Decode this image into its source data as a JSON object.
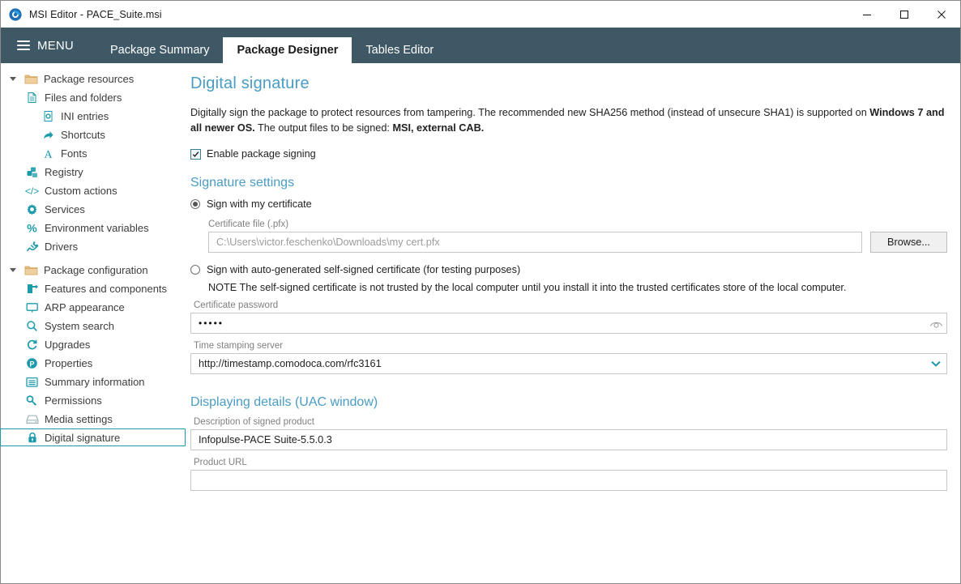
{
  "window": {
    "title": "MSI Editor - PACE_Suite.msi",
    "app_icon": "pace-logo-icon",
    "controls": {
      "minimize": "minimize-icon",
      "maximize": "maximize-icon",
      "close": "close-icon"
    }
  },
  "topbar": {
    "menu_label": "MENU",
    "tabs": [
      {
        "label": "Package Summary",
        "active": false
      },
      {
        "label": "Package Designer",
        "active": true
      },
      {
        "label": "Tables Editor",
        "active": false
      }
    ]
  },
  "sidebar": {
    "items": [
      {
        "label": "Package resources",
        "level": 0,
        "icon": "folder-icon",
        "expanded": true,
        "selected": false
      },
      {
        "label": "Files and folders",
        "level": 1,
        "icon": "document-icon",
        "selected": false
      },
      {
        "label": "INI entries",
        "level": 2,
        "icon": "ini-file-icon",
        "selected": false
      },
      {
        "label": "Shortcuts",
        "level": 2,
        "icon": "shortcut-icon",
        "selected": false
      },
      {
        "label": "Fonts",
        "level": 2,
        "icon": "font-icon",
        "selected": false
      },
      {
        "label": "Registry",
        "level": 1,
        "icon": "registry-icon",
        "selected": false
      },
      {
        "label": "Custom actions",
        "level": 1,
        "icon": "code-icon",
        "selected": false
      },
      {
        "label": "Services",
        "level": 1,
        "icon": "gear-icon",
        "selected": false
      },
      {
        "label": "Environment variables",
        "level": 1,
        "icon": "percent-icon",
        "selected": false
      },
      {
        "label": "Drivers",
        "level": 1,
        "icon": "plug-icon",
        "selected": false
      },
      {
        "label": "Package configuration",
        "level": 0,
        "icon": "folder-icon",
        "expanded": true,
        "selected": false
      },
      {
        "label": "Features and components",
        "level": 1,
        "icon": "features-icon",
        "selected": false
      },
      {
        "label": "ARP appearance",
        "level": 1,
        "icon": "monitor-icon",
        "selected": false
      },
      {
        "label": "System search",
        "level": 1,
        "icon": "search-icon",
        "selected": false
      },
      {
        "label": "Upgrades",
        "level": 1,
        "icon": "refresh-icon",
        "selected": false
      },
      {
        "label": "Properties",
        "level": 1,
        "icon": "properties-icon",
        "selected": false
      },
      {
        "label": "Summary information",
        "level": 1,
        "icon": "list-icon",
        "selected": false
      },
      {
        "label": "Permissions",
        "level": 1,
        "icon": "key-icon",
        "selected": false
      },
      {
        "label": "Media settings",
        "level": 1,
        "icon": "media-icon",
        "selected": false
      },
      {
        "label": "Digital signature",
        "level": 1,
        "icon": "lock-icon",
        "selected": true
      }
    ]
  },
  "page": {
    "title": "Digital signature",
    "description": {
      "part1": "Digitally sign the package to protect resources from tampering. The recommended new SHA256 method (instead of unsecure SHA1) is supported on ",
      "bold1": "Windows 7 and all newer OS.",
      "part2": " The output files to be signed: ",
      "bold2": "MSI, external CAB."
    },
    "enable_signing": {
      "label": "Enable package signing",
      "checked": true
    },
    "signature_settings": {
      "heading": "Signature settings",
      "option_my_cert": {
        "label": "Sign with my certificate",
        "selected": true
      },
      "cert_file": {
        "label": "Certificate file (.pfx)",
        "value": "C:\\Users\\victor.feschenko\\Downloads\\my cert.pfx",
        "is_placeholder": true,
        "browse_label": "Browse..."
      },
      "option_self_signed": {
        "label": "Sign with auto-generated self-signed certificate (for testing purposes)",
        "selected": false
      },
      "note": "NOTE The self-signed certificate is not trusted by the local computer until you install it into the trusted certificates store of the local computer.",
      "password": {
        "label": "Certificate password",
        "value": "•••••",
        "reveal_icon": "eye-icon"
      },
      "timestamp_server": {
        "label": "Time stamping server",
        "value": "http://timestamp.comodoca.com/rfc3161",
        "dropdown_icon": "chevron-down-icon"
      }
    },
    "uac": {
      "heading": "Displaying details (UAC window)",
      "description": {
        "label": "Description of signed product",
        "value": "Infopulse-PACE Suite-5.5.0.3"
      },
      "product_url": {
        "label": "Product URL",
        "value": ""
      }
    }
  },
  "colors": {
    "tabbar_bg": "#3f5866",
    "heading_blue": "#4a9cc4",
    "accent_teal": "#1d9bab",
    "folder_tan": "#e8be86",
    "window_border": "#8a8a8a"
  }
}
